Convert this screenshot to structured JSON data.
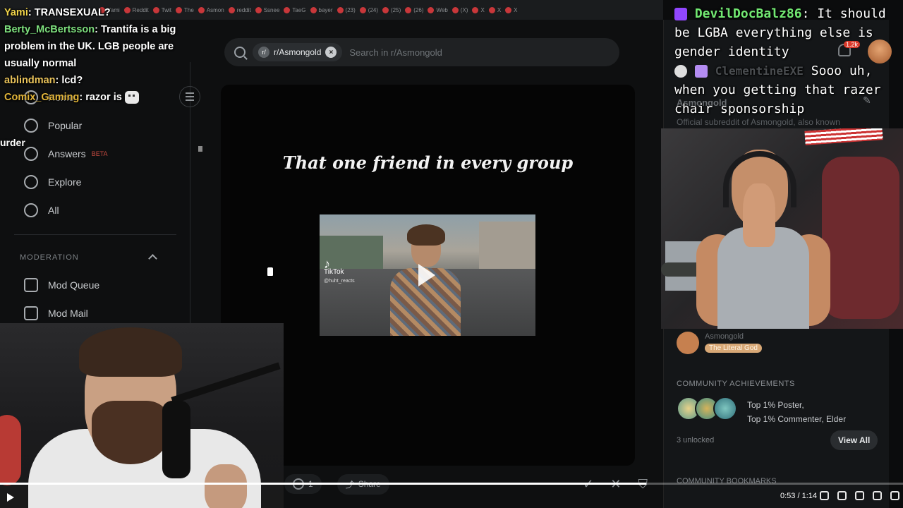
{
  "tabs": [
    "Yami",
    "Reddit",
    "Twit",
    "The",
    "Asmon",
    "reddit",
    "Ssnee",
    "TaeG",
    "bayer",
    "(23)",
    "(24)",
    "(25)",
    "(26)",
    "Web",
    "(X)",
    "X",
    "X",
    "X"
  ],
  "search": {
    "subreddit_chip": "r/Asmongold",
    "placeholder": "Search in r/Asmongold"
  },
  "sidebar": {
    "items": [
      {
        "label": "Home",
        "icon": "home-icon"
      },
      {
        "label": "Popular",
        "icon": "popular-icon"
      },
      {
        "label": "Answers",
        "icon": "answers-icon",
        "badge": "BETA"
      },
      {
        "label": "Explore",
        "icon": "explore-icon"
      },
      {
        "label": "All",
        "icon": "all-icon"
      }
    ],
    "moderation_header": "MODERATION",
    "mod_items": [
      {
        "label": "Mod Queue",
        "icon": "mod-queue-icon"
      },
      {
        "label": "Mod Mail",
        "icon": "mod-mail-icon"
      }
    ]
  },
  "post": {
    "caption": "That one friend in every group",
    "video_watermark": "TikTok",
    "video_handle": "@huht_reacts",
    "comment_count": "1",
    "share_label": "Share"
  },
  "right_panel": {
    "community_name": "Asmongold",
    "description": "Official subreddit of Asmongold, also known",
    "moderator_name": "Asmongold",
    "moderator_flair": "The Literal God",
    "achievements_header": "COMMUNITY ACHIEVEMENTS",
    "achievement_line1": "Top 1% Poster,",
    "achievement_line2": "Top 1% Commenter, Elder",
    "unlocked": "3 unlocked",
    "view_all": "View All",
    "bookmarks_header": "COMMUNITY BOOKMARKS",
    "notification_count": "1.2k"
  },
  "chat_left": [
    {
      "user": "Yami",
      "text": ": TRANSEXUAL?"
    },
    {
      "user": "Berty_McBertsson",
      "text": ": Trantifa is a big problem in the UK. LGB people are usually normal"
    },
    {
      "user": "ablindman",
      "text": ": lcd?"
    },
    {
      "user": "Comix_Gaming",
      "text": ": razor is"
    }
  ],
  "chat_left_cut": "urder",
  "chat_right": {
    "user1": "DevilDocBalz86",
    "msg1": ": It should be LGBA everything else is gender identity",
    "user2": "ClementineEXE",
    "msg2": "Sooo uh, when you getting that razer chair sponsorship"
  },
  "player": {
    "time": "0:53 / 1:14",
    "progress": 0.716
  },
  "colors": {
    "reddit_bg": "#0e0f10",
    "chat_name_green": "#72e872",
    "flair_orange": "#d8a876"
  }
}
